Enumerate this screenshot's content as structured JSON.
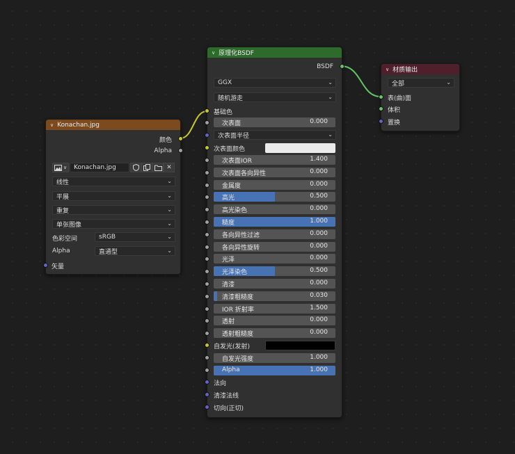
{
  "image_node": {
    "title": "Konachan.jpg",
    "outputs": [
      "颜色",
      "Alpha"
    ],
    "image_name": "Konachan.jpg",
    "interpolation": "线性",
    "projection": "平展",
    "extension": "重复",
    "source": "单张图像",
    "colorspace_label": "色彩空间",
    "colorspace_value": "sRGB",
    "alpha_label": "Alpha",
    "alpha_value": "直通型",
    "vector_label": "矢量",
    "header_color": "#7c4a1f"
  },
  "bsdf_node": {
    "title": "原理化BSDF",
    "output": "BSDF",
    "distribution": "GGX",
    "subsurface_method": "随机游走",
    "base_color_label": "基础色",
    "subsurface": {
      "label": "次表面",
      "value": "0.000"
    },
    "subsurface_radius": "次表面半径",
    "subsurface_color_label": "次表面颜色",
    "subsurface_color": "#ebebeb",
    "params": [
      {
        "label": "次表面IOR",
        "value": "1.400",
        "fill": 0.0
      },
      {
        "label": "次表面各向异性",
        "value": "0.000",
        "fill": 0.0
      },
      {
        "label": "金属度",
        "value": "0.000",
        "fill": 0.0
      },
      {
        "label": "高光",
        "value": "0.500",
        "fill": 0.5
      },
      {
        "label": "高光染色",
        "value": "0.000",
        "fill": 0.0
      },
      {
        "label": "糙度",
        "value": "1.000",
        "fill": 1.0
      },
      {
        "label": "各向异性过滤",
        "value": "0.000",
        "fill": 0.0
      },
      {
        "label": "各向异性旋转",
        "value": "0.000",
        "fill": 0.0
      },
      {
        "label": "光泽",
        "value": "0.000",
        "fill": 0.0
      },
      {
        "label": "光泽染色",
        "value": "0.500",
        "fill": 0.5
      },
      {
        "label": "清漆",
        "value": "0.000",
        "fill": 0.0
      },
      {
        "label": "清漆粗糙度",
        "value": "0.030",
        "fill": 0.03
      },
      {
        "label": "IOR 折射率",
        "value": "1.500",
        "fill": 0.0
      },
      {
        "label": "透射",
        "value": "0.000",
        "fill": 0.0
      },
      {
        "label": "透射粗糙度",
        "value": "0.000",
        "fill": 0.0
      }
    ],
    "emission_label": "自发光(发射)",
    "emission_color": "#000000",
    "emission_strength": {
      "label": "自发光强度",
      "value": "1.000",
      "fill": 0.0
    },
    "alpha": {
      "label": "Alpha",
      "value": "1.000",
      "fill": 1.0
    },
    "normal_label": "法向",
    "clearcoat_normal_label": "清漆法线",
    "tangent_label": "切向(正切)",
    "header_color": "#2d6a2b"
  },
  "output_node": {
    "title": "材质输出",
    "target": "全部",
    "inputs": [
      "表(曲)面",
      "体积",
      "置换"
    ],
    "header_color": "#4f1f2b"
  }
}
